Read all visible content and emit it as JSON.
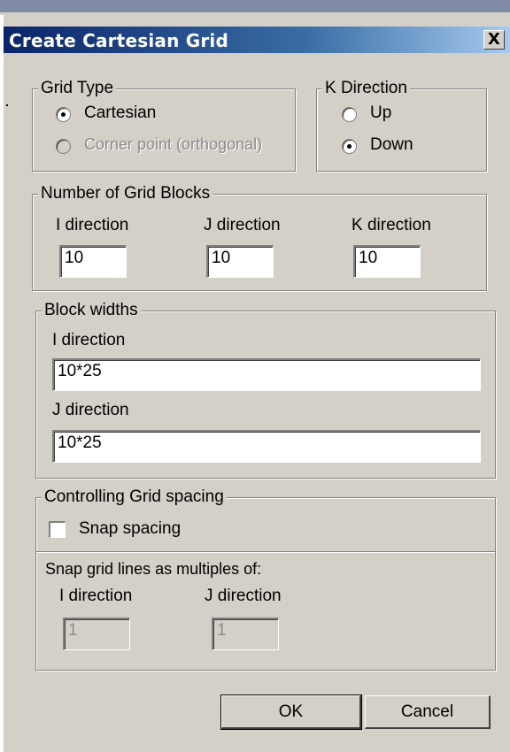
{
  "window": {
    "title": "Create Cartesian Grid",
    "close_label": "X"
  },
  "grid_type": {
    "legend": "Grid Type",
    "options": [
      {
        "label": "Cartesian",
        "selected": true,
        "enabled": true
      },
      {
        "label": "Corner point (orthogonal)",
        "selected": false,
        "enabled": false
      }
    ]
  },
  "k_direction": {
    "legend": "K Direction",
    "options": [
      {
        "label": "Up",
        "selected": false
      },
      {
        "label": "Down",
        "selected": true
      }
    ]
  },
  "grid_blocks": {
    "legend": "Number of Grid Blocks",
    "i_label": "I direction",
    "i_value": "10",
    "j_label": "J direction",
    "j_value": "10",
    "k_label": "K direction",
    "k_value": "10"
  },
  "block_widths": {
    "legend": "Block widths",
    "i_label": "I direction",
    "i_value": "10*25",
    "j_label": "J direction",
    "j_value": "10*25"
  },
  "grid_spacing": {
    "legend": "Controlling Grid spacing",
    "snap_label": "Snap spacing",
    "snap_checked": false,
    "multiples_label": "Snap grid lines as multiples of:",
    "i_label": "I direction",
    "i_value": "1",
    "j_label": "J direction",
    "j_value": "1"
  },
  "buttons": {
    "ok": "OK",
    "cancel": "Cancel"
  }
}
